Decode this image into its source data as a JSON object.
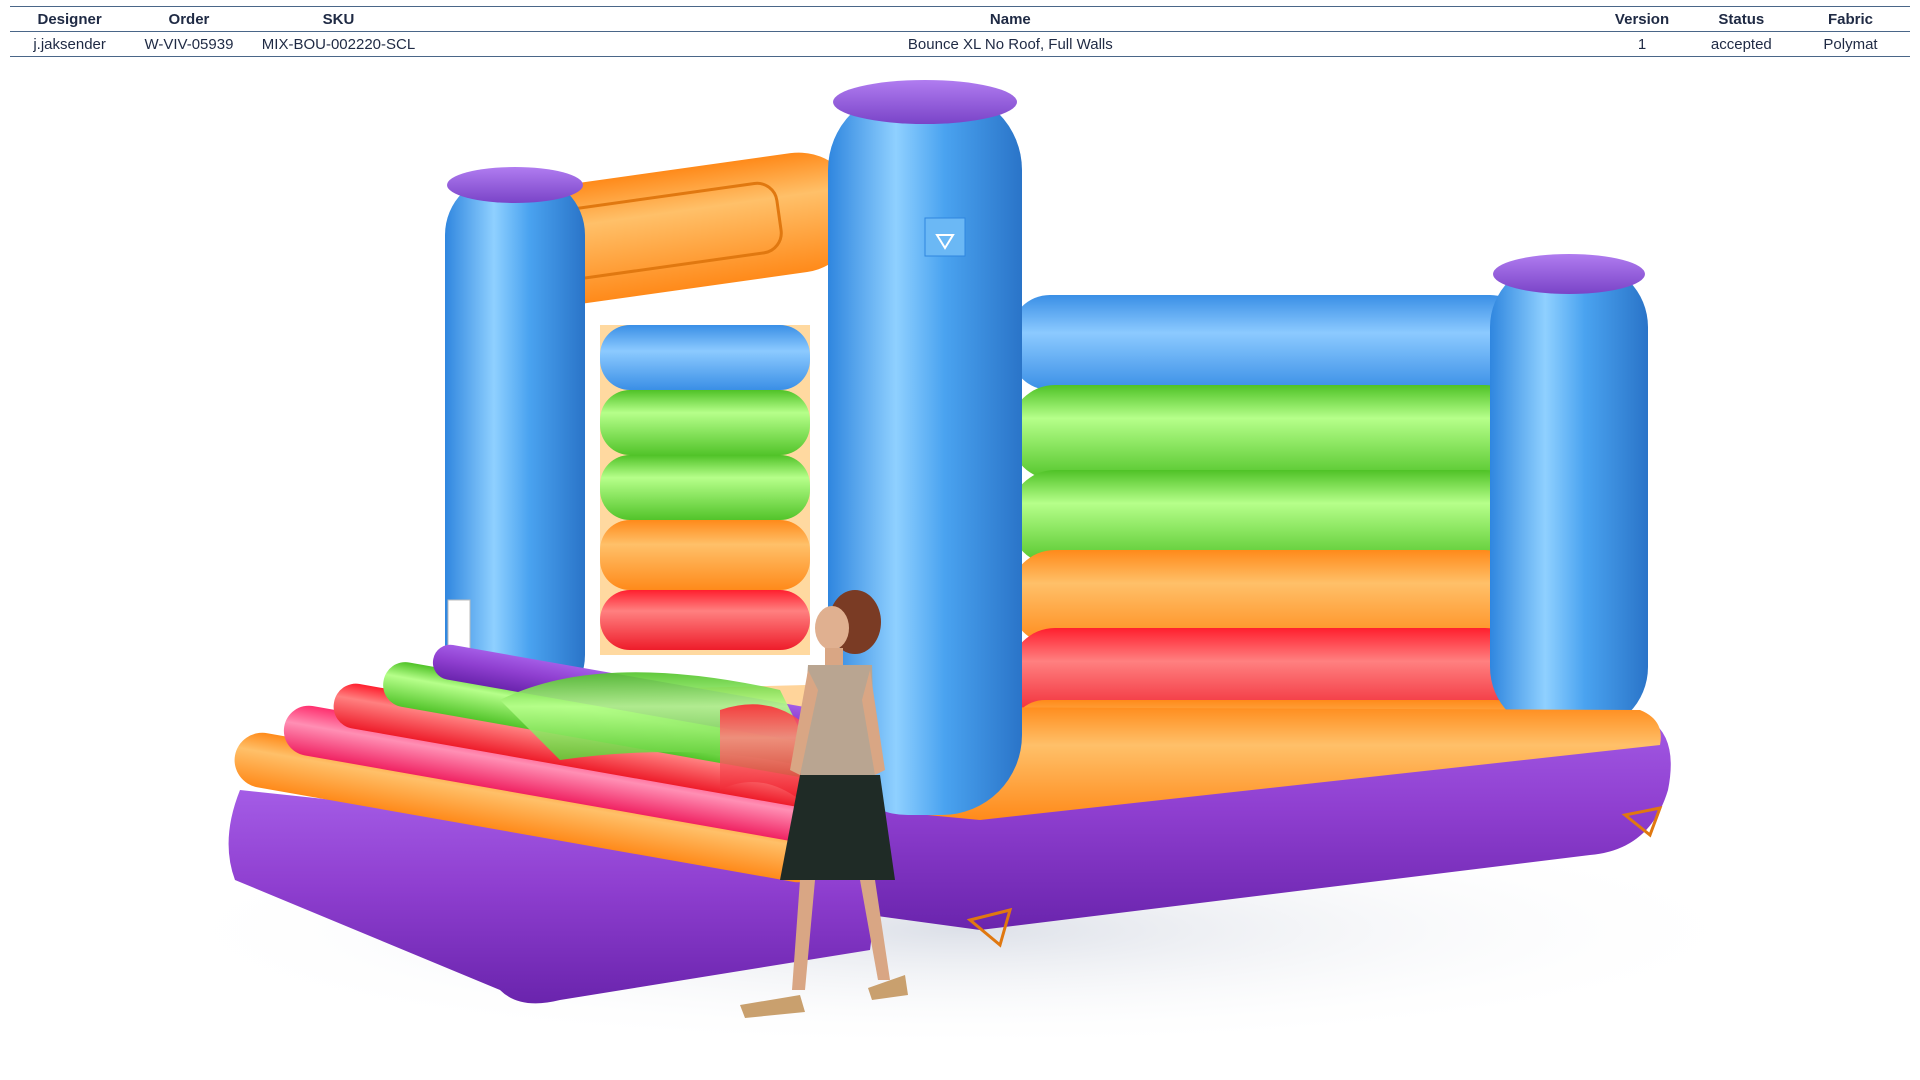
{
  "spec_table": {
    "headers": {
      "designer": "Designer",
      "order": "Order",
      "sku": "SKU",
      "name": "Name",
      "version": "Version",
      "status": "Status",
      "fabric": "Fabric"
    },
    "row": {
      "designer": "j.jaksender",
      "order": "W-VIV-05939",
      "sku": "MIX-BOU-002220-SCL",
      "name": "Bounce XL No Roof, Full Walls",
      "version": "1",
      "status": "accepted",
      "fabric": "Polymat"
    }
  },
  "render": {
    "colors": {
      "tower_blue": "#4aa3f0",
      "tower_cap": "#8a5ad6",
      "stripe_green": "#7ee04a",
      "stripe_orange": "#ffa033",
      "stripe_red": "#ff3a3a",
      "stripe_pink": "#ff4f8a",
      "base_purple": "#8f3fd0",
      "floor_orange": "#ffb347"
    }
  }
}
